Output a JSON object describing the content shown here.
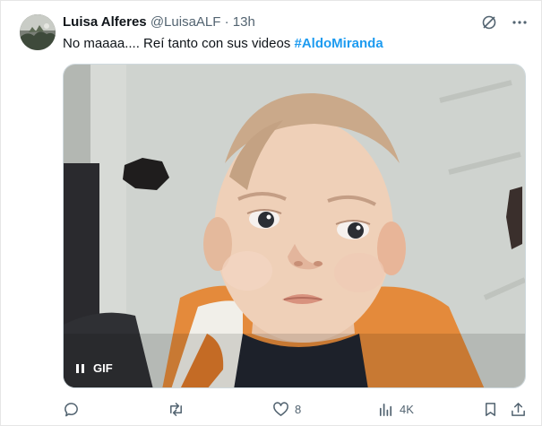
{
  "author": {
    "name": "Luisa Alferes",
    "handle": "@LuisaALF",
    "separator": "·",
    "time": "13h"
  },
  "tweet": {
    "text_prefix": "No maaaa.... Reí tanto con sus videos ",
    "hashtag": "#AldoMiranda"
  },
  "media": {
    "type": "gif",
    "badge": "GIF",
    "state_icon": "pause-icon"
  },
  "actions": {
    "reply_count": "",
    "retweet_count": "",
    "like_count": "8",
    "views_count": "4K"
  },
  "colors": {
    "accent": "#1d9bf0",
    "muted": "#536471"
  }
}
